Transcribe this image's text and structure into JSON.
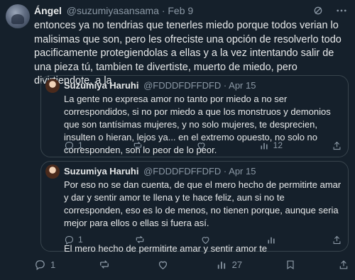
{
  "post": {
    "author_name": "Ángel",
    "author_handle": "@suzumiyasansama · Feb 9",
    "text": "entonces ya no tendrias que tenerles miedo porque todos verian lo malisimas que son, pero les ofreciste una opción de resolverlo todo pacificamente protegiendolas a ellas y a la vez intentando salir de una pieza tú, tambien te divertiste, muerto de miedo, pero divirtiendote, a la",
    "replies": "1",
    "reposts": "",
    "likes": "",
    "views": "27"
  },
  "quotes": [
    {
      "author_name": "Suzumiya Haruhi",
      "author_handle": "@FDDDFDFFDFD · Apr 15",
      "text": "La gente no expresa amor no tanto por miedo a no ser correspondidos, si no por miedo a que los monstruos y demonios que son tantísimas mujeres, y no solo mujeres, te desprecien, insulten o hieran, lejos ya... en el extremo opuesto, no solo no corresponden, son lo peor de lo peor.",
      "replies": "1",
      "reposts": "",
      "likes": "",
      "views": "12"
    },
    {
      "author_name": "Suzumiya Haruhi",
      "author_handle": "@FDDDFDFFDFD · Apr 15",
      "text": "Por eso no se dan cuenta, de que el mero hecho de permitirte amar y dar y sentir amor te llena y te hace feliz, aun si no te corresponden, eso es lo de menos, no tienen porque, aunque seria mejor para ellos o ellas si fuera así.",
      "text2": "El mero hecho de permitirte amar y sentir amor te",
      "replies": "1",
      "reposts": "",
      "likes": "",
      "views": ""
    }
  ],
  "icons": [
    "grok-icon",
    "more-icon",
    "reply-icon",
    "repost-icon",
    "like-icon",
    "views-icon",
    "bookmark-icon",
    "share-icon"
  ]
}
